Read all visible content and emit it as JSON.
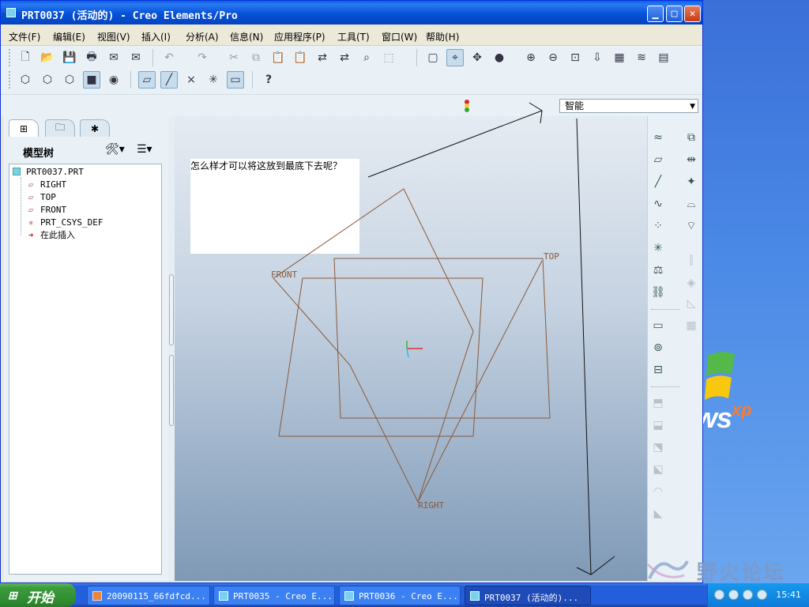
{
  "window": {
    "title": "PRT0037 (活动的) - Creo Elements/Pro",
    "buttons": {
      "minimize": "▁",
      "maximize": "□",
      "close": "✕"
    }
  },
  "menu": [
    "文件(F)",
    "编辑(E)",
    "视图(V)",
    "插入(I)",
    "分析(A)",
    "信息(N)",
    "应用程序(P)",
    "工具(T)",
    "窗口(W)",
    "帮助(H)"
  ],
  "toolbar": {
    "help_label": "?"
  },
  "filter": {
    "value": "智能"
  },
  "panel": {
    "tree_title": "模型树",
    "tree": [
      {
        "label": "PRT0037.PRT",
        "icon": "part-icon"
      },
      {
        "label": "RIGHT",
        "icon": "datum-plane-icon"
      },
      {
        "label": "TOP",
        "icon": "datum-plane-icon"
      },
      {
        "label": "FRONT",
        "icon": "datum-plane-icon"
      },
      {
        "label": "PRT_CSYS_DEF",
        "icon": "csys-icon"
      },
      {
        "label": "在此插入",
        "icon": "insert-arrow-icon"
      }
    ]
  },
  "graphics": {
    "note": "怎么样才可以将这放到最底下去呢？",
    "plane_labels": {
      "front": "FRONT",
      "top": "TOP",
      "right": "RIGHT"
    },
    "plane_color": "#8a5a3a"
  },
  "watermark": {
    "text": "野火论坛"
  },
  "taskbar": {
    "start_label": "开始",
    "tasks": [
      {
        "label": "20090115_66fdfcd...",
        "icon": "camera-icon"
      },
      {
        "label": "PRT0035 - Creo E...",
        "icon": "creo-icon"
      },
      {
        "label": "PRT0036 - Creo E...",
        "icon": "creo-icon"
      },
      {
        "label": "PRT0037 (活动的)...",
        "icon": "creo-icon"
      }
    ],
    "clock": "15:41"
  },
  "desktop": {
    "logo_text": "ws",
    "logo_super": "xp"
  }
}
